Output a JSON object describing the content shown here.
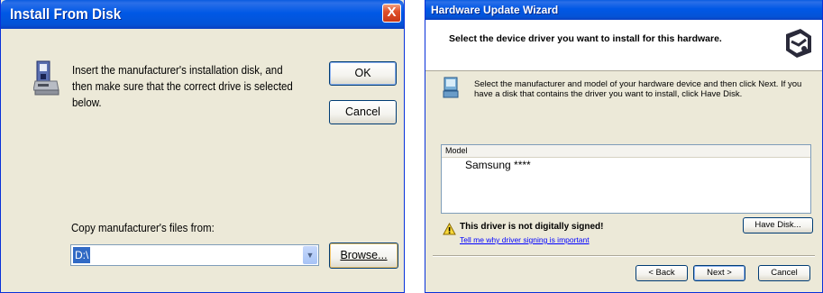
{
  "install_dialog": {
    "title": "Install From Disk",
    "close_glyph": "X",
    "message": "Insert the manufacturer's installation disk, and then make sure that the correct drive is selected below.",
    "ok_label": "OK",
    "cancel_label": "Cancel",
    "copy_label": "Copy manufacturer's files from:",
    "path_value": "D:\\",
    "browse_label": "Browse...",
    "icon": "floppy-disk-icon"
  },
  "wizard": {
    "title": "Hardware Update Wizard",
    "heading": "Select the device driver you want to install for this hardware.",
    "message": "Select the manufacturer and model of your hardware device and then click Next. If you have a disk that contains the driver you want to install, click Have Disk.",
    "model_header": "Model",
    "models": [
      "Samsung ****"
    ],
    "warning_text": "This driver is not digitally signed!",
    "warning_link": "Tell me why driver signing is important",
    "have_disk_label": "Have Disk...",
    "back_label": "< Back",
    "next_label": "Next >",
    "cancel_label": "Cancel",
    "icons": [
      "hardware-wizard-icon",
      "device-icon",
      "warning-icon"
    ]
  },
  "colors": {
    "titlebar": "#0058e6",
    "dialog_bg": "#ece9d8",
    "selection": "#316ac5",
    "close_button": "#e0502a"
  }
}
